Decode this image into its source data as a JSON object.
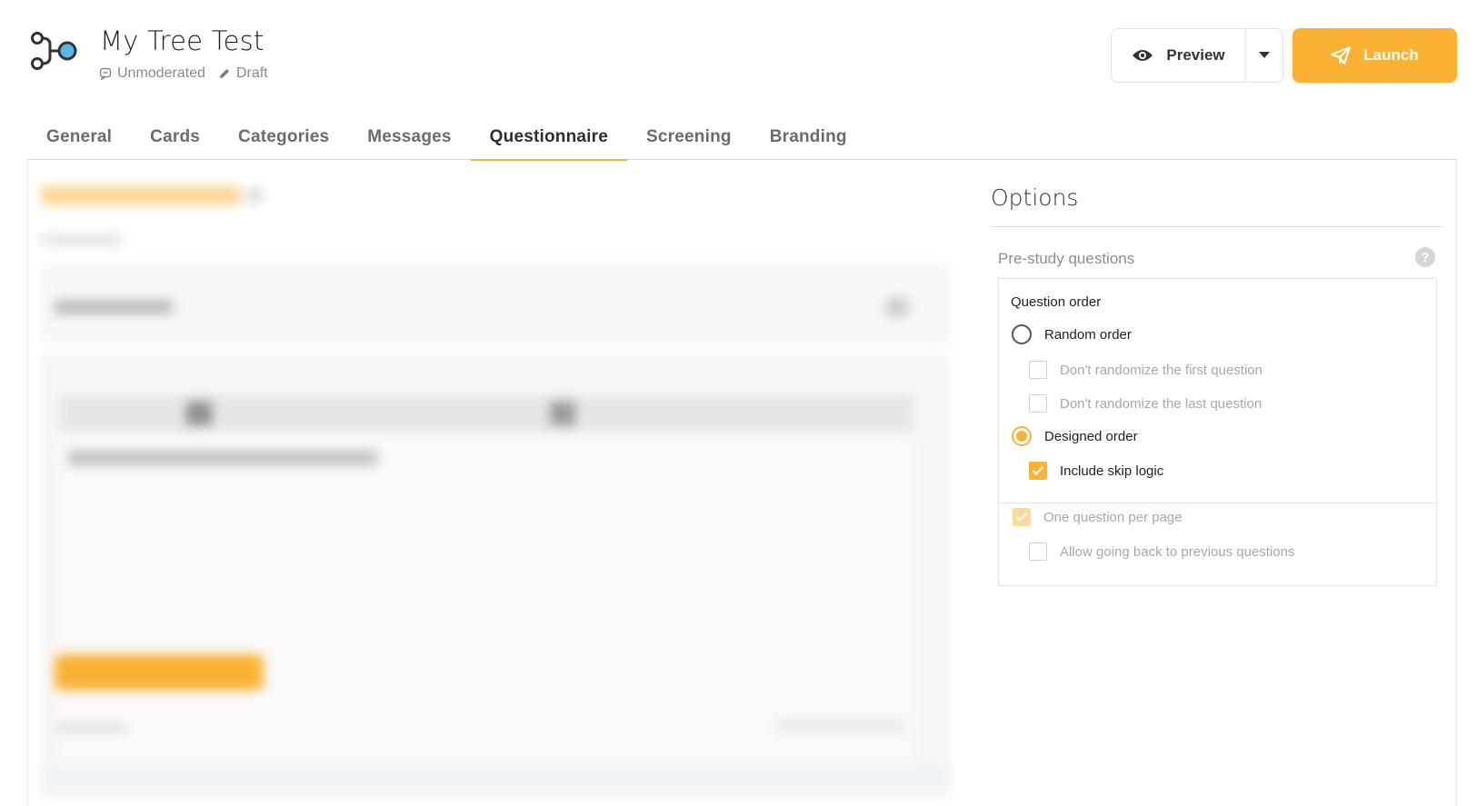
{
  "header": {
    "title": "My Tree Test",
    "mode": "Unmoderated",
    "status": "Draft",
    "preview_label": "Preview",
    "launch_label": "Launch",
    "accent": "#fbb234"
  },
  "tabs": [
    {
      "label": "General",
      "active": false
    },
    {
      "label": "Cards",
      "active": false
    },
    {
      "label": "Categories",
      "active": false
    },
    {
      "label": "Messages",
      "active": false
    },
    {
      "label": "Questionnaire",
      "active": true
    },
    {
      "label": "Screening",
      "active": false
    },
    {
      "label": "Branding",
      "active": false
    }
  ],
  "options": {
    "title": "Options",
    "section_label": "Pre-study questions",
    "help_icon": "?",
    "question_order_label": "Question order",
    "random_order_label": "Random order",
    "random_order_selected": false,
    "dont_randomize_first_label": "Don't randomize the first question",
    "dont_randomize_last_label": "Don't randomize the last question",
    "designed_order_label": "Designed order",
    "designed_order_selected": true,
    "include_skip_logic_label": "Include skip logic",
    "include_skip_logic_checked": true,
    "one_question_per_page_label": "One question per page",
    "one_question_per_page_checked": true,
    "allow_going_back_label": "Allow going back to previous questions",
    "allow_going_back_checked": false
  }
}
